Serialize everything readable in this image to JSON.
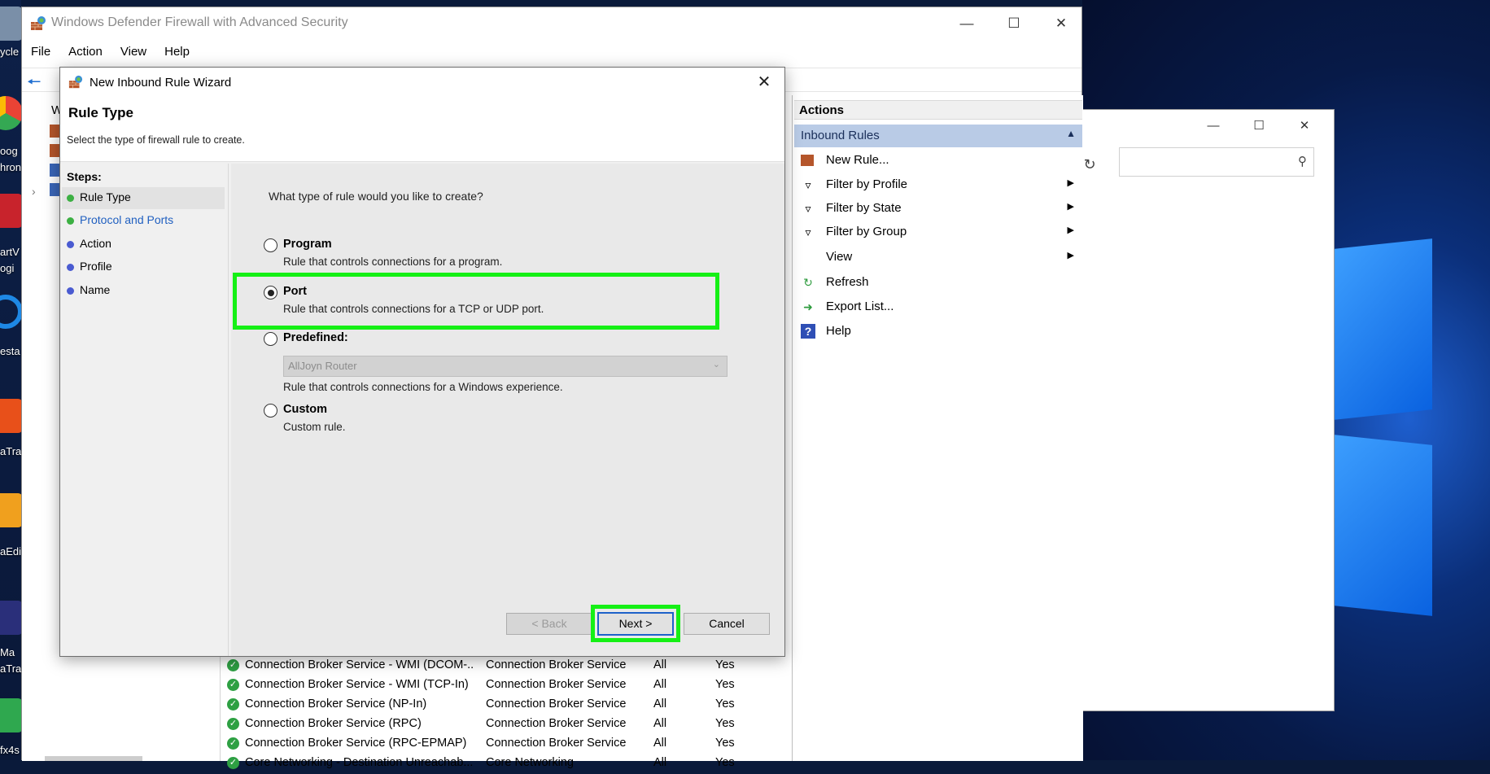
{
  "desktop": {
    "labels": [
      "ycle",
      "oog",
      "hron",
      "artV",
      "ogi",
      "esta",
      "aTra",
      "aEdi",
      "Ma",
      "aTrac",
      "fx4s"
    ]
  },
  "mmc": {
    "title": "Windows Defender Firewall with Advanced Security",
    "menu": [
      "File",
      "Action",
      "View",
      "Help"
    ],
    "tree_item": "W",
    "list_rows": [
      {
        "name": "Connection Broker Service - WMI (DCOM-...",
        "group": "Connection Broker Service",
        "profile": "All",
        "enabled": "Yes"
      },
      {
        "name": "Connection Broker Service - WMI (TCP-In)",
        "group": "Connection Broker Service",
        "profile": "All",
        "enabled": "Yes"
      },
      {
        "name": "Connection Broker Service (NP-In)",
        "group": "Connection Broker Service",
        "profile": "All",
        "enabled": "Yes"
      },
      {
        "name": "Connection Broker Service (RPC)",
        "group": "Connection Broker Service",
        "profile": "All",
        "enabled": "Yes"
      },
      {
        "name": "Connection Broker Service (RPC-EPMAP)",
        "group": "Connection Broker Service",
        "profile": "All",
        "enabled": "Yes"
      },
      {
        "name": "Core Networking - Destination Unreachab...",
        "group": "Core Networking",
        "profile": "All",
        "enabled": "Yes"
      }
    ]
  },
  "actions": {
    "header": "Actions",
    "group": "Inbound Rules",
    "items": [
      {
        "label": "New Rule...",
        "icon": "new-rule-icon"
      },
      {
        "label": "Filter by Profile",
        "icon": "filter-icon",
        "submenu": true
      },
      {
        "label": "Filter by State",
        "icon": "filter-icon",
        "submenu": true
      },
      {
        "label": "Filter by Group",
        "icon": "filter-icon",
        "submenu": true
      },
      {
        "label": "View",
        "icon": "",
        "submenu": true
      },
      {
        "label": "Refresh",
        "icon": "refresh-icon"
      },
      {
        "label": "Export List...",
        "icon": "export-icon"
      },
      {
        "label": "Help",
        "icon": "help-icon"
      }
    ]
  },
  "wizard": {
    "title": "New Inbound Rule Wizard",
    "page_title": "Rule Type",
    "page_subtitle": "Select the type of firewall rule to create.",
    "steps_title": "Steps:",
    "steps": [
      {
        "label": "Rule Type",
        "state": "current"
      },
      {
        "label": "Protocol and Ports",
        "state": "link"
      },
      {
        "label": "Action",
        "state": "pending"
      },
      {
        "label": "Profile",
        "state": "pending"
      },
      {
        "label": "Name",
        "state": "pending"
      }
    ],
    "question": "What type of rule would you like to create?",
    "options": [
      {
        "label": "Program",
        "desc": "Rule that controls connections for a program.",
        "selected": false
      },
      {
        "label": "Port",
        "desc": "Rule that controls connections for a TCP or UDP port.",
        "selected": true
      },
      {
        "label": "Predefined:",
        "desc": "Rule that controls connections for a Windows experience.",
        "selected": false
      },
      {
        "label": "Custom",
        "desc": "Custom rule.",
        "selected": false
      }
    ],
    "predefined_value": "AllJoyn Router",
    "buttons": {
      "back": "< Back",
      "next": "Next >",
      "cancel": "Cancel"
    }
  },
  "colors": {
    "highlight": "#15f015",
    "actions_group_bg": "#b9cbe6",
    "step_dot_green": "#3cb043",
    "step_dot_blue": "#4a5bd1"
  }
}
